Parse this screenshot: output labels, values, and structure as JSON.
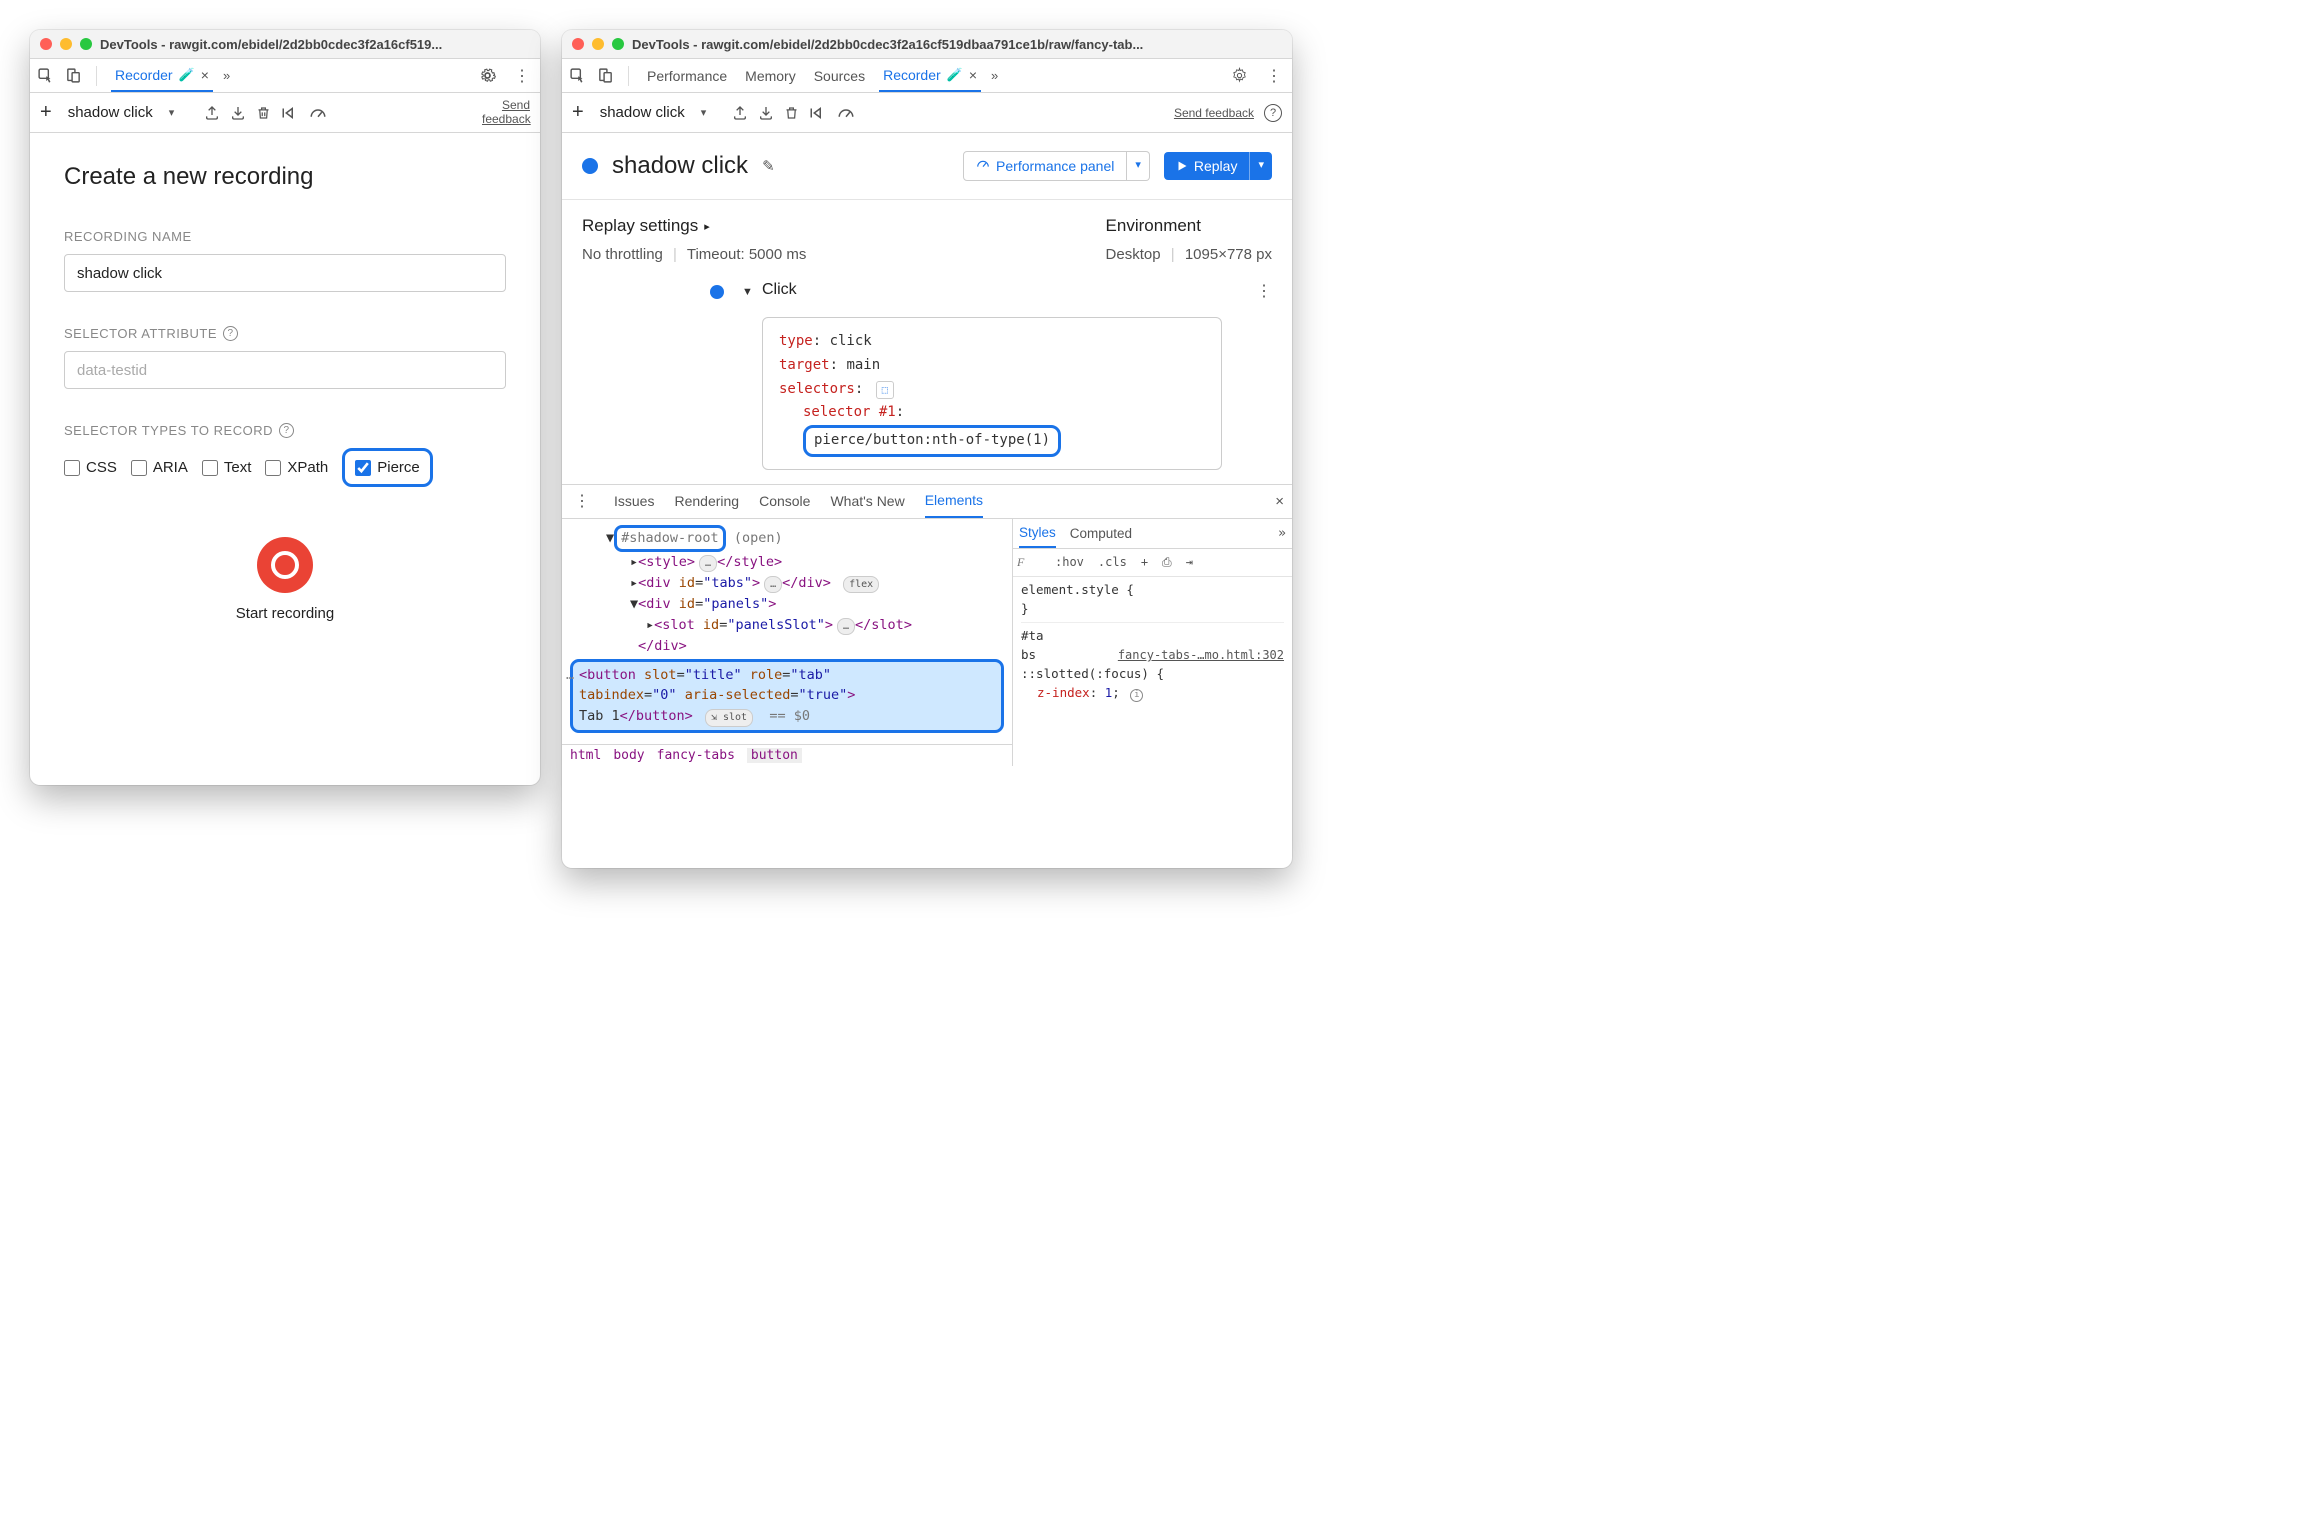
{
  "left": {
    "title": "DevTools - rawgit.com/ebidel/2d2bb0cdec3f2a16cf519...",
    "tab_recorder": "Recorder",
    "toolbar": {
      "rec_name": "shadow click",
      "send_feedback": "Send feedback"
    },
    "heading": "Create a new recording",
    "labels": {
      "recording_name": "RECORDING NAME",
      "selector_attribute": "SELECTOR ATTRIBUTE",
      "selector_types": "SELECTOR TYPES TO RECORD"
    },
    "fields": {
      "recording_name_value": "shadow click",
      "selector_attribute_placeholder": "data-testid"
    },
    "checks": {
      "css": "CSS",
      "aria": "ARIA",
      "text": "Text",
      "xpath": "XPath",
      "pierce": "Pierce"
    },
    "start_recording": "Start recording"
  },
  "right": {
    "title": "DevTools - rawgit.com/ebidel/2d2bb0cdec3f2a16cf519dbaa791ce1b/raw/fancy-tab...",
    "tabs": {
      "performance": "Performance",
      "memory": "Memory",
      "sources": "Sources",
      "recorder": "Recorder"
    },
    "toolbar": {
      "rec_name": "shadow click",
      "send_feedback": "Send feedback"
    },
    "header": {
      "title": "shadow click",
      "perf_panel": "Performance panel",
      "replay": "Replay"
    },
    "settings": {
      "replay_settings": "Replay settings",
      "no_throttling": "No throttling",
      "timeout": "Timeout: 5000 ms",
      "environment": "Environment",
      "desktop": "Desktop",
      "dimensions": "1095×778 px"
    },
    "step": {
      "name": "Click",
      "type_k": "type",
      "type_v": "click",
      "target_k": "target",
      "target_v": "main",
      "selectors_k": "selectors",
      "selector1_k": "selector #1",
      "selector1_v": "pierce/button:nth-of-type(1)"
    },
    "drawer_tabs": {
      "issues": "Issues",
      "rendering": "Rendering",
      "console": "Console",
      "whats_new": "What's New",
      "elements": "Elements"
    },
    "dom": {
      "shadow_root": "#shadow-root",
      "open": "(open)",
      "style_open": "<style>",
      "style_close": "</style>",
      "div_tabs": "<div id=\"tabs\">",
      "div_close": "</div>",
      "flex_badge": "flex",
      "div_panels": "<div id=\"panels\">",
      "slot_panels": "<slot id=\"panelsSlot\">",
      "slot_close": "</slot>",
      "button_line1": "<button slot=\"title\" role=\"tab\"",
      "button_line2": "tabindex=\"0\" aria-selected=\"true\">",
      "button_text": "Tab 1",
      "button_close": "</button>",
      "slot_badge": "slot",
      "eq0": "== $0"
    },
    "crumbs": {
      "html": "html",
      "body": "body",
      "fancy_tabs": "fancy-tabs",
      "button": "button"
    },
    "styles_tabs": {
      "styles": "Styles",
      "computed": "Computed"
    },
    "filter": {
      "placeholder": "F",
      "hov": ":hov",
      "cls": ".cls"
    },
    "rules": {
      "element_style": "element.style {",
      "brace_close": "}",
      "tabs_sel": "#tabs",
      "source": "fancy-tabs-…mo.html:302",
      "slotted": "::slotted(:focus) {",
      "zindex_p": "z-index",
      "zindex_v": "1"
    }
  }
}
